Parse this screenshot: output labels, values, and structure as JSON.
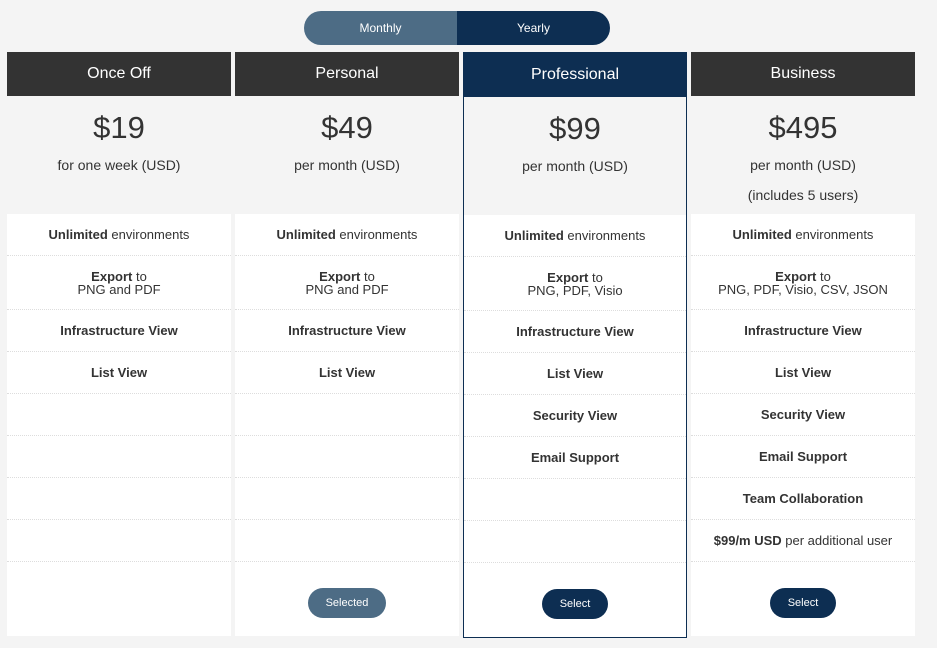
{
  "toggle": {
    "monthly_label": "Monthly",
    "yearly_label": "Yearly"
  },
  "plans": [
    {
      "name": "Once Off",
      "price": "$19",
      "period": "for one week (USD)",
      "extra": "",
      "features": [
        {
          "bold": "Unlimited",
          "rest": " environments",
          "sub": ""
        },
        {
          "bold": "Export",
          "rest": " to",
          "sub": "PNG and PDF"
        },
        {
          "bold": "Infrastructure View",
          "rest": "",
          "sub": ""
        },
        {
          "bold": "List View",
          "rest": "",
          "sub": ""
        },
        {
          "bold": "",
          "rest": "",
          "sub": ""
        },
        {
          "bold": "",
          "rest": "",
          "sub": ""
        },
        {
          "bold": "",
          "rest": "",
          "sub": ""
        },
        {
          "bold": "",
          "rest": "",
          "sub": ""
        }
      ],
      "button": "",
      "button_state": "none"
    },
    {
      "name": "Personal",
      "price": "$49",
      "period": "per month (USD)",
      "extra": "",
      "features": [
        {
          "bold": "Unlimited",
          "rest": " environments",
          "sub": ""
        },
        {
          "bold": "Export",
          "rest": " to",
          "sub": "PNG and PDF"
        },
        {
          "bold": "Infrastructure View",
          "rest": "",
          "sub": ""
        },
        {
          "bold": "List View",
          "rest": "",
          "sub": ""
        },
        {
          "bold": "",
          "rest": "",
          "sub": ""
        },
        {
          "bold": "",
          "rest": "",
          "sub": ""
        },
        {
          "bold": "",
          "rest": "",
          "sub": ""
        },
        {
          "bold": "",
          "rest": "",
          "sub": ""
        }
      ],
      "button": "Selected",
      "button_state": "selected"
    },
    {
      "name": "Professional",
      "price": "$99",
      "period": "per month (USD)",
      "extra": "",
      "features": [
        {
          "bold": "Unlimited",
          "rest": " environments",
          "sub": ""
        },
        {
          "bold": "Export",
          "rest": " to",
          "sub": "PNG, PDF, Visio"
        },
        {
          "bold": "Infrastructure View",
          "rest": "",
          "sub": ""
        },
        {
          "bold": "List View",
          "rest": "",
          "sub": ""
        },
        {
          "bold": "Security View",
          "rest": "",
          "sub": ""
        },
        {
          "bold": "Email Support",
          "rest": "",
          "sub": ""
        },
        {
          "bold": "",
          "rest": "",
          "sub": ""
        },
        {
          "bold": "",
          "rest": "",
          "sub": ""
        }
      ],
      "button": "Select",
      "button_state": "select"
    },
    {
      "name": "Business",
      "price": "$495",
      "period": "per month (USD)",
      "extra": "(includes 5 users)",
      "features": [
        {
          "bold": "Unlimited",
          "rest": " environments",
          "sub": ""
        },
        {
          "bold": "Export",
          "rest": " to",
          "sub": "PNG, PDF, Visio, CSV, JSON"
        },
        {
          "bold": "Infrastructure View",
          "rest": "",
          "sub": ""
        },
        {
          "bold": "List View",
          "rest": "",
          "sub": ""
        },
        {
          "bold": "Security View",
          "rest": "",
          "sub": ""
        },
        {
          "bold": "Email Support",
          "rest": "",
          "sub": ""
        },
        {
          "bold": "Team Collaboration",
          "rest": "",
          "sub": ""
        },
        {
          "bold": "$99/m USD",
          "rest": " per additional user",
          "sub": ""
        }
      ],
      "button": "Select",
      "button_state": "select"
    }
  ]
}
